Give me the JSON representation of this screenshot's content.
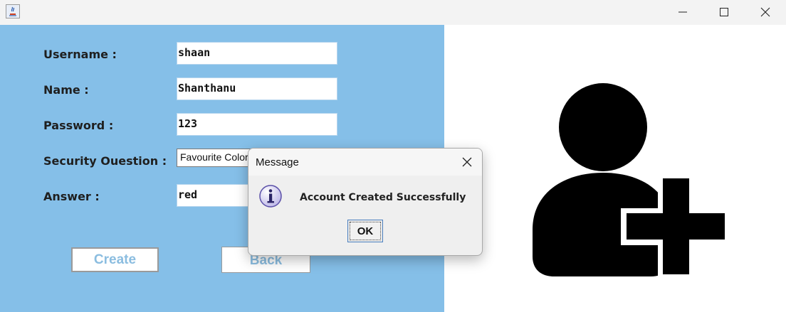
{
  "window": {
    "title": "",
    "icons": {
      "app": "java-app-icon",
      "minimize": "minimize-icon",
      "maximize": "maximize-icon",
      "close": "close-icon"
    }
  },
  "form": {
    "username_label": "Username :",
    "username_value": "shaan",
    "name_label": "Name :",
    "name_value": "Shanthanu",
    "password_label": "Password :",
    "password_value": "123",
    "security_label": "Security Ouestion :",
    "security_selected": "Favourite Color",
    "answer_label": "Answer :",
    "answer_value": "red",
    "create_label": "Create",
    "back_label": "Back"
  },
  "dialog": {
    "title": "Message",
    "message": "Account Created Successfully",
    "ok_label": "OK",
    "icon": "information-icon"
  },
  "illustration": {
    "icon": "add-user-icon"
  },
  "colors": {
    "panel_background": "#85bfe8",
    "button_text": "#8bbde0",
    "dialog_background": "#efefef",
    "illustration": "#000000"
  }
}
